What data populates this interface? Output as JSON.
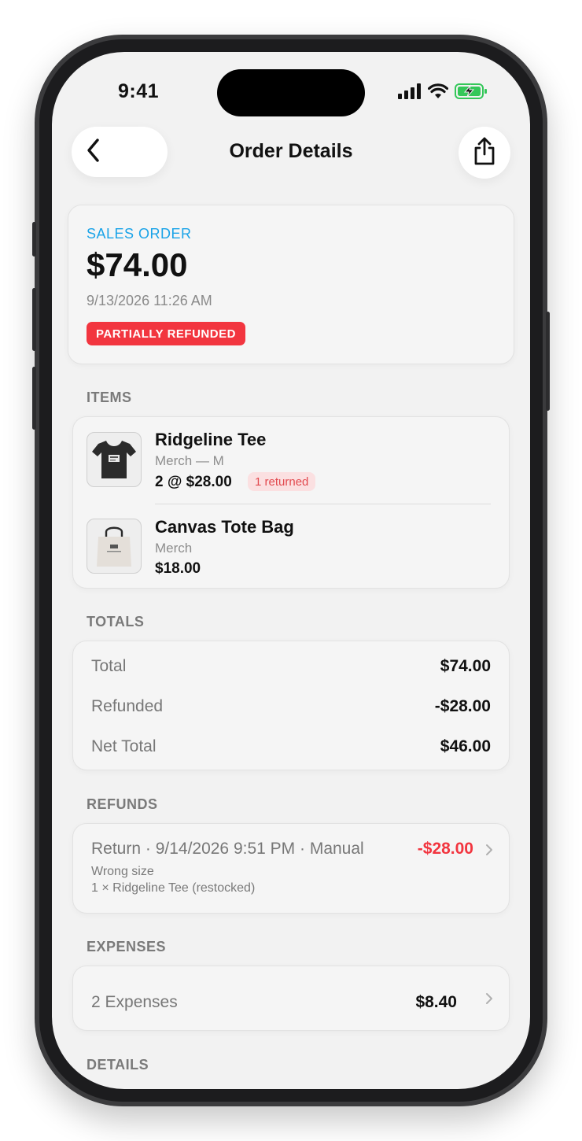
{
  "status_bar": {
    "time": "9:41"
  },
  "nav": {
    "title": "Order Details"
  },
  "order": {
    "type_label": "SALES ORDER",
    "amount": "$74.00",
    "date": "9/13/2026 11:26 AM",
    "status": "PARTIALLY REFUNDED"
  },
  "items": {
    "section_label": "ITEMS",
    "list": [
      {
        "name": "Ridgeline Tee",
        "variant": "Merch — M",
        "price": "2 @ $28.00",
        "badge": "1 returned",
        "thumb_icon": "tshirt-icon"
      },
      {
        "name": "Canvas Tote Bag",
        "variant": "Merch",
        "price": "$18.00",
        "thumb_icon": "tote-bag-icon"
      }
    ]
  },
  "totals": {
    "section_label": "TOTALS",
    "rows": [
      {
        "label": "Total",
        "value": "$74.00"
      },
      {
        "label": "Refunded",
        "value": "-$28.00"
      },
      {
        "label": "Net Total",
        "value": "$46.00"
      }
    ]
  },
  "refunds": {
    "section_label": "REFUNDS",
    "list": [
      {
        "title": "Return · 9/14/2026 9:51 PM · Manual",
        "amount": "-$28.00",
        "reason": "Wrong size",
        "detail": "1 × Ridgeline Tee (restocked)"
      }
    ]
  },
  "expenses": {
    "section_label": "EXPENSES",
    "summary_label": "2 Expenses",
    "summary_value": "$8.40"
  },
  "details": {
    "section_label": "DETAILS"
  },
  "colors": {
    "accent": "#1aa3e8",
    "danger": "#f2353f",
    "badge_bg": "#fbe0e1",
    "battery": "#34c759"
  }
}
